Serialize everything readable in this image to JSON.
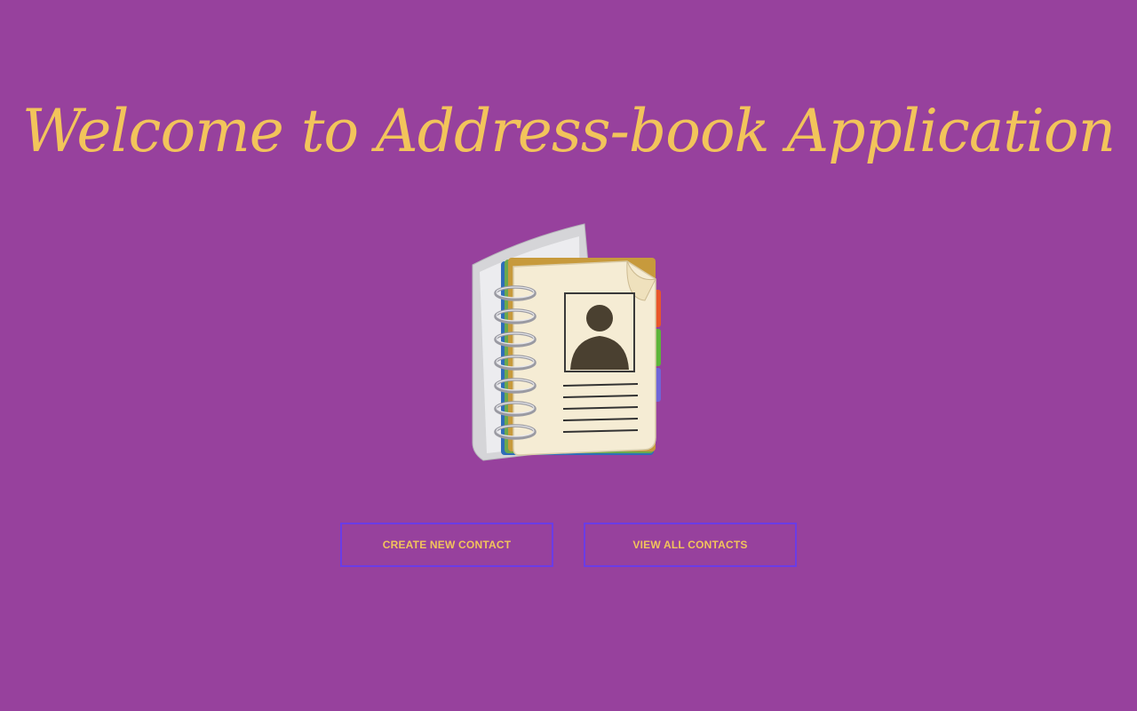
{
  "page": {
    "title": "Welcome to Address-book Application",
    "background_color": "#97419d",
    "accent_color": "#f2c45b",
    "button_border_color": "#6b3ce6"
  },
  "hero": {
    "icon": "address-book-icon"
  },
  "actions": {
    "create_label": "CREATE NEW CONTACT",
    "view_label": "VIEW ALL CONTACTS"
  }
}
